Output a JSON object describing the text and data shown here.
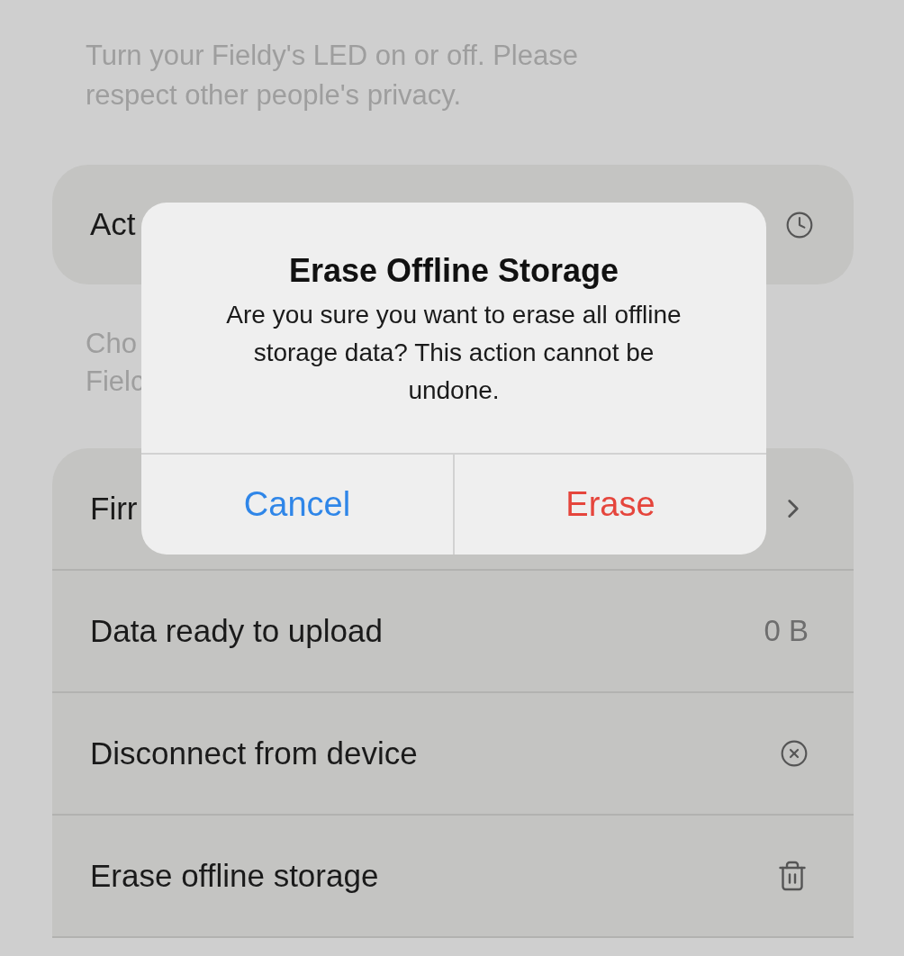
{
  "led_description": "Turn your Fieldy's LED on or off. Please respect other people's privacy.",
  "activity_row": {
    "label": "Act"
  },
  "activity_description": [
    "Cho",
    "Fielc"
  ],
  "settings_rows": [
    {
      "kind": "chevron",
      "label": "Firr"
    },
    {
      "kind": "value",
      "label": "Data ready to upload",
      "value": "0 B"
    },
    {
      "kind": "disconnect",
      "label": "Disconnect from device"
    },
    {
      "kind": "trash",
      "label": "Erase offline storage"
    }
  ],
  "dialog": {
    "title": "Erase Offline Storage",
    "message": "Are you sure you want to erase all offline storage data? This action cannot be undone.",
    "buttons": [
      {
        "kind": "cancel",
        "label": "Cancel"
      },
      {
        "kind": "destructive",
        "label": "Erase"
      }
    ]
  }
}
